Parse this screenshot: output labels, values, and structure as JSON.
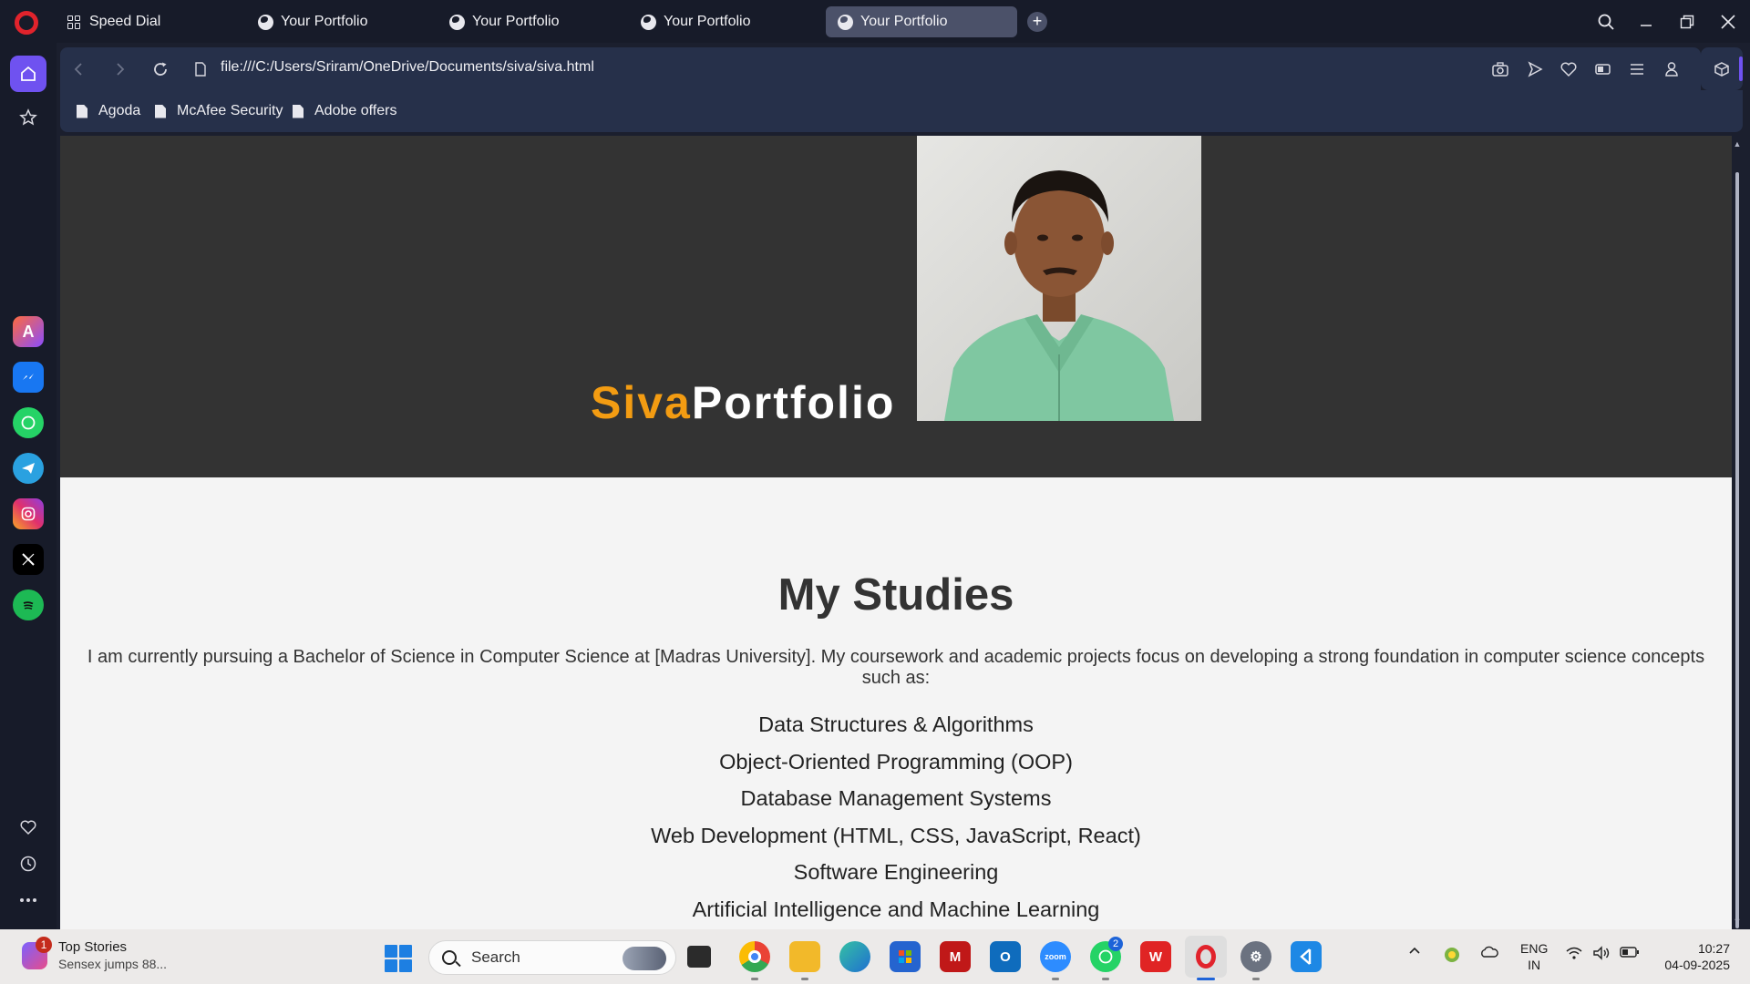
{
  "browser": {
    "tabs": [
      {
        "label": "Speed Dial",
        "icon": "speed-dial-icon"
      },
      {
        "label": "Your Portfolio",
        "icon": "globe-icon"
      },
      {
        "label": "Your Portfolio",
        "icon": "globe-icon"
      },
      {
        "label": "Your Portfolio",
        "icon": "globe-icon"
      },
      {
        "label": "Your Portfolio",
        "icon": "globe-icon",
        "active": true
      }
    ],
    "new_tab": "+",
    "address": "file:///C:/Users/Sriram/OneDrive/Documents/siva/siva.html",
    "bookmarks": [
      "Agoda",
      "McAfee Security",
      "Adobe offers"
    ],
    "accent": "#6f52f0"
  },
  "page": {
    "hero": {
      "name_first": "Siva",
      "name_last": "Portfolio",
      "first_color": "#f39c12",
      "bg_color": "#333333"
    },
    "studies": {
      "title": "My Studies",
      "intro": "I am currently pursuing a Bachelor of Science in Computer Science at [Madras University]. My coursework and academic projects focus on developing a strong foundation in computer science concepts such as:",
      "items": [
        "Data Structures & Algorithms",
        "Object-Oriented Programming (OOP)",
        "Database Management Systems",
        "Web Development (HTML, CSS, JavaScript, React)",
        "Software Engineering",
        "Artificial Intelligence and Machine Learning"
      ]
    }
  },
  "taskbar": {
    "news_title": "Top Stories",
    "news_sub": "Sensex jumps 88...",
    "news_badge": "1",
    "search_placeholder": "Search",
    "whatsapp_badge": "2",
    "lang_line1": "ENG",
    "lang_line2": "IN",
    "time": "10:27",
    "date": "04-09-2025"
  }
}
